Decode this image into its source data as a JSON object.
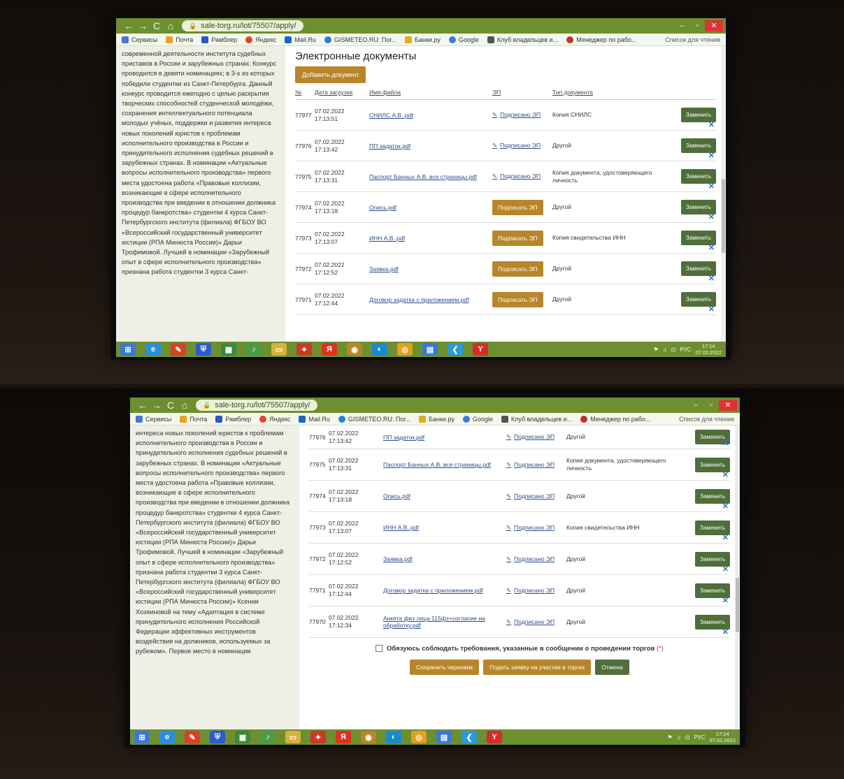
{
  "browser": {
    "url": "sale-torg.ru/lot/75507/apply/",
    "back": "←",
    "forward": "→",
    "reload": "C",
    "home": "⌂",
    "minimize": "–",
    "maximize": "▫",
    "close": "✕",
    "bookmarks": [
      {
        "label": "Сервисы",
        "color": "#4a77d4"
      },
      {
        "label": "Почта",
        "color": "#f0a020"
      },
      {
        "label": "Рамблер",
        "color": "#2a57c0"
      },
      {
        "label": "Яндекс",
        "color": "#e8402a"
      },
      {
        "label": "Mail.Ru",
        "color": "#1a66cc"
      },
      {
        "label": "GISMETEO.RU: Пог...",
        "color": "#2a7fd0"
      },
      {
        "label": "Банки.ру",
        "color": "#d8b020"
      },
      {
        "label": "Google",
        "color": "#3b7be0"
      },
      {
        "label": "Клуб владельцев и...",
        "color": "#555555"
      },
      {
        "label": "Менеджер по рабо...",
        "color": "#c0302a"
      }
    ],
    "reading_list": "Список для чтения"
  },
  "top": {
    "left_text": "современной деятельности института судебных приставов в России и зарубежных странах. Конкурс проводился в девяти номинациях; в 3-х из которых победили студентки из Санкт-Петербурга. Данный конкурс проводится ежегодно с целью раскрытия творческих способностей студенческой молодёжи, сохранения интеллектуального потенциала молодых учёных, поддержки и развития интереса новых поколений юристов к проблемам исполнительного производства в России и принудительного исполнения судебных решений в зарубежных странах. В номинации «Актуальные вопросы исполнительного производства» первого места удостоена работа «Правовые коллизии, возникающие в сфере исполнительного производства при введении в отношении должника процедур банкротства» студентки 4 курса Санкт-Петербургского института (филиала) ФГБОУ ВО «Всероссийский государственный университет юстиции (РПА Минюста России)» Дарьи Трофимовой. Лучшей в номинации «Зарубежный опыт в сфере исполнительного производства» признана работа студентки 3 курса Санкт-",
    "section_title": "Электронные документы",
    "add_button": "Добавить документ",
    "headers": {
      "id": "№",
      "date": "Дата загрузки",
      "file": "Имя файла",
      "sig": "ЭП",
      "type": "Тип документа"
    },
    "rows": [
      {
        "id": "77977",
        "date": "07.02.2022",
        "time": "17:13:51",
        "file": "СНИЛС А.В..pdf",
        "signed": true,
        "sig_label": "Подписано ЭП",
        "type": "Копия СНИЛС",
        "replace": "Заменить"
      },
      {
        "id": "77976",
        "date": "07.02.2022",
        "time": "17:13:42",
        "file": "ПП задаток.pdf",
        "signed": true,
        "sig_label": "Подписано ЭП",
        "type": "Другой",
        "replace": "Заменить"
      },
      {
        "id": "77975",
        "date": "07.02.2022",
        "time": "17:13:31",
        "file": "Паспорт Банных А.В. все страницы.pdf",
        "signed": true,
        "sig_label": "Подписано ЭП",
        "type": "Копия документа, удостоверяющего личность",
        "replace": "Заменить"
      },
      {
        "id": "77974",
        "date": "07.02.2022",
        "time": "17:13:18",
        "file": "Опись.pdf",
        "signed": false,
        "sig_label": "Подписать ЭП",
        "type": "Другой",
        "replace": "Заменить"
      },
      {
        "id": "77973",
        "date": "07.02.2022",
        "time": "17:13:07",
        "file": "ИНН А.В..pdf",
        "signed": false,
        "sig_label": "Подписать ЭП",
        "type": "Копия свидетельства ИНН",
        "replace": "Заменить"
      },
      {
        "id": "77972",
        "date": "07.02.2022",
        "time": "17:12:52",
        "file": "Заявка.pdf",
        "signed": false,
        "sig_label": "Подписать ЭП",
        "type": "Другой",
        "replace": "Заменить"
      },
      {
        "id": "77971",
        "date": "07.02.2022",
        "time": "17:12:44",
        "file": "Договор задатка с приложением.pdf",
        "signed": false,
        "sig_label": "Подписать ЭП",
        "type": "Другой",
        "replace": "Заменить"
      }
    ]
  },
  "bottom": {
    "left_text": "интереса новых поколений юристов к проблемам исполнительного производства в России и принудительного исполнения судебных решений в зарубежных странах. В номинации «Актуальные вопросы исполнительного производства» первого места удостоена работа «Правовые коллизии, возникающие в сфере исполнительного производства при введении в отношении должника процедур банкротства» студентки 4 курса Санкт-Петербургского института (филиала) ФГБОУ ВО «Всероссийский государственный университет юстиции (РПА Минюста России)» Дарьи Трофимовой. Лучшей в номинации «Зарубежный опыт в сфере исполнительного производства» признана работа студентки 3 курса Санкт-Петербургского института (филиала) ФГБОУ ВО «Всероссийский государственный университет юстиции (РПА Минюста России)» Ксении Хозяиновой на тему «Адаптация в системе принудительного исполнения Российской Федерации эффективных инструментов воздействия на должников, используемых за рубежом». Первое место в номинации",
    "rows": [
      {
        "id": "77976",
        "date": "07.02.2022",
        "time": "17:13:42",
        "file": "ПП задаток.pdf",
        "sig_label": "Подписано ЭП",
        "type": "Другой",
        "replace": "Заменить"
      },
      {
        "id": "77975",
        "date": "07.02.2022",
        "time": "17:13:31",
        "file": "Паспорт Банных А.В. все страницы.pdf",
        "sig_label": "Подписано ЭП",
        "type": "Копия документа, удостоверяющего личность",
        "replace": "Заменить"
      },
      {
        "id": "77974",
        "date": "07.02.2022",
        "time": "17:13:18",
        "file": "Опись.pdf",
        "sig_label": "Подписано ЭП",
        "type": "Другой",
        "replace": "Заменить"
      },
      {
        "id": "77973",
        "date": "07.02.2022",
        "time": "17:13:07",
        "file": "ИНН А.В..pdf",
        "sig_label": "Подписано ЭП",
        "type": "Копия свидетельства ИНН",
        "replace": "Заменить"
      },
      {
        "id": "77972",
        "date": "07.02.2022",
        "time": "17:12:52",
        "file": "Заявка.pdf",
        "sig_label": "Подписано ЭП",
        "type": "Другой",
        "replace": "Заменить"
      },
      {
        "id": "77971",
        "date": "07.02.2022",
        "time": "17:12:44",
        "file": "Договор задатка с приложением.pdf",
        "sig_label": "Подписано ЭП",
        "type": "Другой",
        "replace": "Заменить"
      },
      {
        "id": "77970",
        "date": "07.02.2022",
        "time": "17:12:34",
        "file": "Анкета физ лица 115фз+согласие на обработку.pdf",
        "sig_label": "Подписано ЭП",
        "type": "Другой",
        "replace": "Заменить"
      }
    ],
    "agree_text": "Обязуюсь соблюдать требования, указанные в сообщении о проведении торгов",
    "agree_req": "(*)",
    "save_draft": "Сохранить черновик",
    "submit": "Подать заявку на участие в торгах",
    "cancel": "Отмена"
  },
  "taskbar": {
    "lang": "РУС",
    "time": "17:14",
    "date": "07.02.2022",
    "icons": [
      {
        "name": "windows-start-icon",
        "glyph": "⊞",
        "color": "#3a78d8"
      },
      {
        "name": "internet-explorer-icon",
        "glyph": "e",
        "color": "#2a8fe0"
      },
      {
        "name": "paint-icon",
        "glyph": "✎",
        "color": "#d8402a"
      },
      {
        "name": "defender-icon",
        "glyph": "⛨",
        "color": "#2a5bd0"
      },
      {
        "name": "spreadsheet-icon",
        "glyph": "▦",
        "color": "#3a8a3a"
      },
      {
        "name": "media-icon",
        "glyph": "♪",
        "color": "#4a9a4a"
      },
      {
        "name": "folder-icon",
        "glyph": "▭",
        "color": "#d8b040"
      },
      {
        "name": "game-icon",
        "glyph": "✦",
        "color": "#c83a2a"
      },
      {
        "name": "yandex-icon",
        "glyph": "Я",
        "color": "#e03020"
      },
      {
        "name": "app-icon",
        "glyph": "◉",
        "color": "#b8862a"
      },
      {
        "name": "edge-icon",
        "glyph": "◐",
        "color": "#1a8ad0"
      },
      {
        "name": "chrome-icon",
        "glyph": "◎",
        "color": "#e0a020"
      },
      {
        "name": "notes-icon",
        "glyph": "▤",
        "color": "#3a78d8"
      },
      {
        "name": "arrow-app-icon",
        "glyph": "❮",
        "color": "#2a9ad8"
      },
      {
        "name": "yandex-browser-icon",
        "glyph": "Y",
        "color": "#d82a2a"
      }
    ]
  }
}
